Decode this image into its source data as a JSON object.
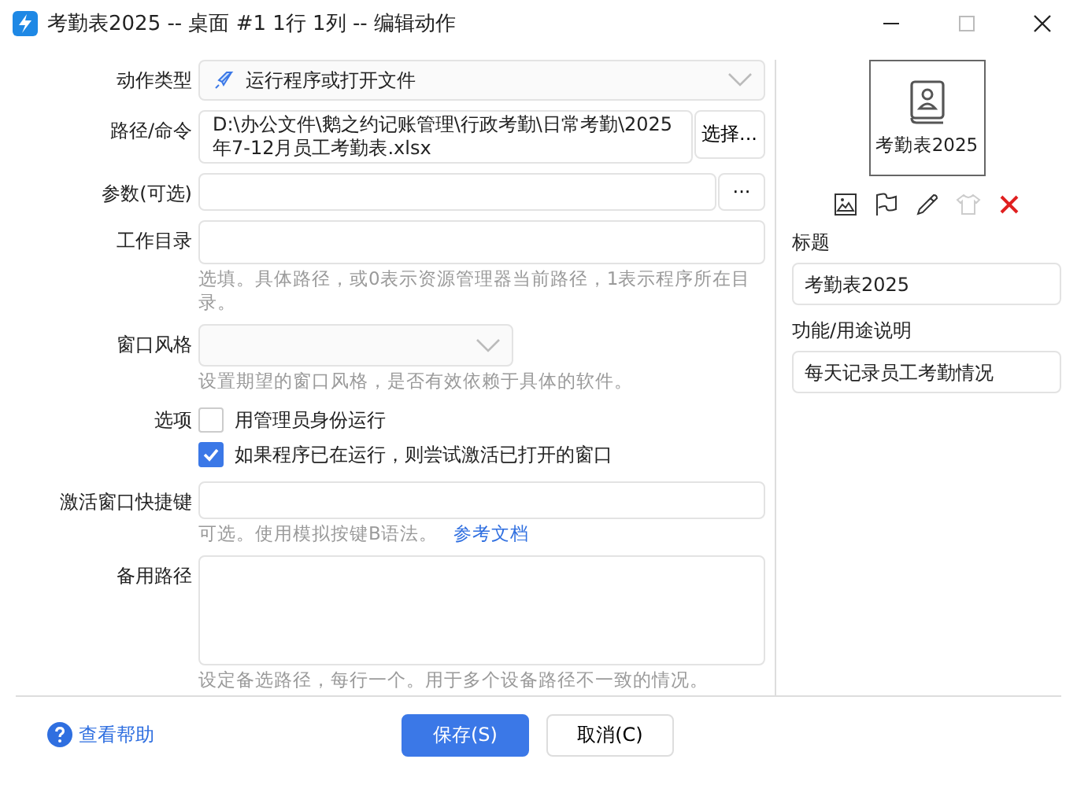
{
  "window": {
    "title": "考勤表2025 -- 桌面 #1 1行 1列 -- 编辑动作"
  },
  "form": {
    "action_type": {
      "label": "动作类型",
      "value": "运行程序或打开文件"
    },
    "path": {
      "label": "路径/命令",
      "value": "D:\\办公文件\\鹅之约记账管理\\行政考勤\\日常考勤\\2025年7-12月员工考勤表.xlsx",
      "button": "选择..."
    },
    "params": {
      "label": "参数(可选)",
      "button": "···"
    },
    "workdir": {
      "label": "工作目录",
      "hint": "选填。具体路径，或0表示资源管理器当前路径，1表示程序所在目录。"
    },
    "window_style": {
      "label": "窗口风格",
      "hint": "设置期望的窗口风格，是否有效依赖于具体的软件。"
    },
    "options": {
      "label": "选项",
      "items": [
        {
          "label": "用管理员身份运行",
          "checked": false
        },
        {
          "label": "如果程序已在运行，则尝试激活已打开的窗口",
          "checked": true
        }
      ]
    },
    "hotkey": {
      "label": "激活窗口快捷键",
      "hint": "可选。使用模拟按键B语法。",
      "link": "参考文档"
    },
    "alt_path": {
      "label": "备用路径",
      "hint": "设定备选路径，每行一个。用于多个设备路径不一致的情况。"
    }
  },
  "side": {
    "preview_label": "考勤表2025",
    "title_label": "标题",
    "title_value": "考勤表2025",
    "desc_label": "功能/用途说明",
    "desc_value": "每天记录员工考勤情况"
  },
  "footer": {
    "help": "查看帮助",
    "save": "保存(S)",
    "cancel": "取消(C)"
  }
}
